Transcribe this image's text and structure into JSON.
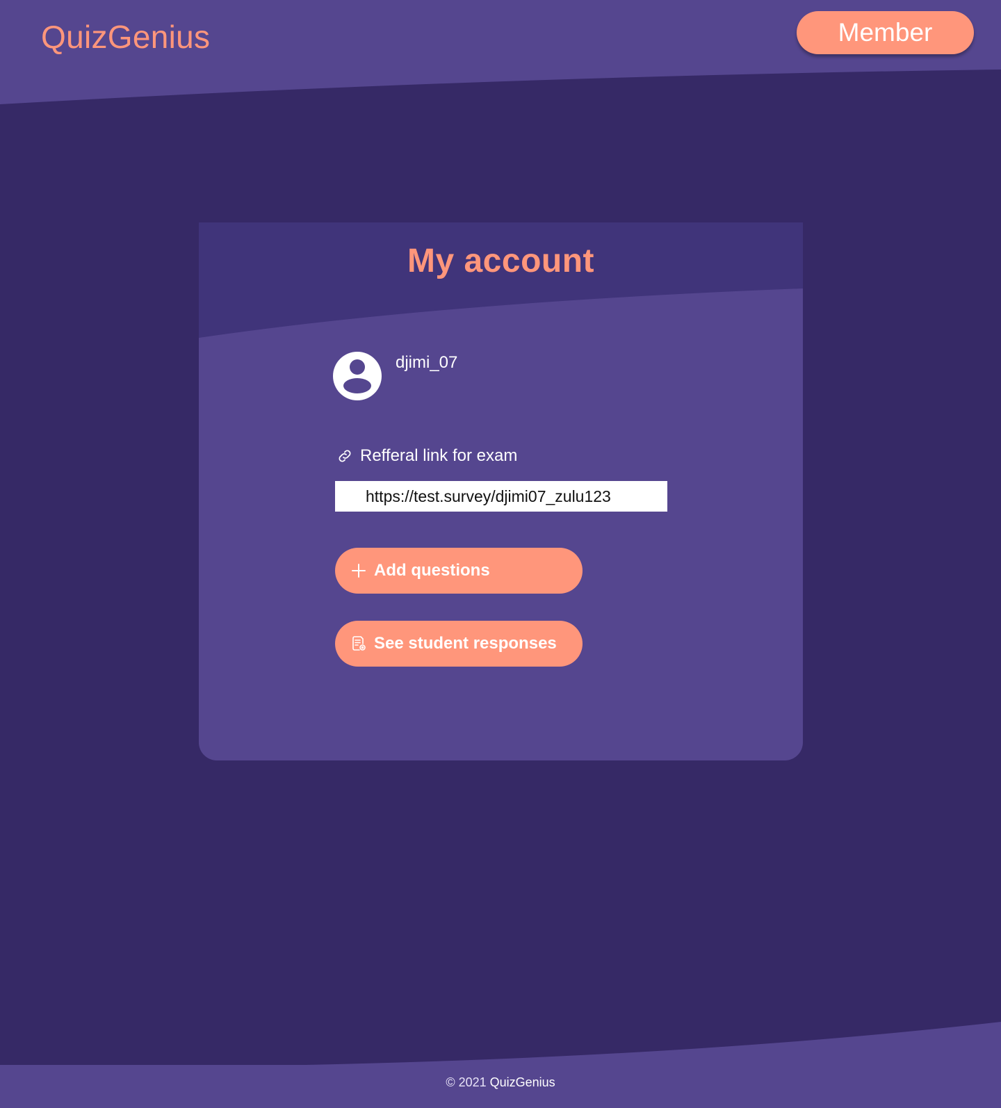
{
  "header": {
    "brand": "QuizGenius",
    "member_button": "Member"
  },
  "card": {
    "title": "My account",
    "username": "djimi_07",
    "referral": {
      "label": "Refferal link for exam",
      "value": "https://test.survey/djimi07_zulu123"
    },
    "buttons": {
      "add_questions": "Add questions",
      "see_responses": "See student responses"
    }
  },
  "footer": {
    "copyright": "© 2021",
    "brand": "QuizGenius"
  },
  "icons": {
    "avatar": "user-avatar-icon",
    "link": "link-icon",
    "add": "plus-icon",
    "responses": "document-search-icon"
  },
  "colors": {
    "background": "#362966",
    "panel": "#55468f",
    "panel_dark": "#40347a",
    "accent": "#ff967b",
    "text": "#ffffff"
  }
}
